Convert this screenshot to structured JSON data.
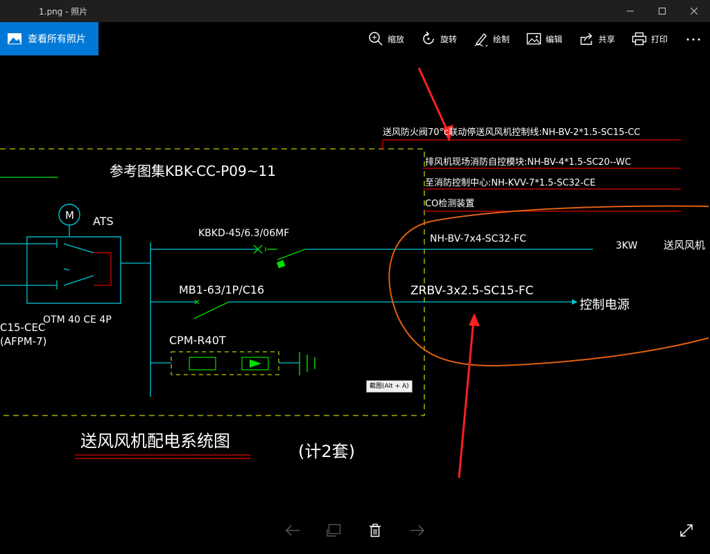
{
  "window": {
    "title": "1.png - 照片",
    "minimize_icon": "minimize-icon",
    "maximize_icon": "maximize-icon",
    "close_icon": "close-icon"
  },
  "appbar": {
    "view_all_label": "查看所有照片",
    "tools": [
      {
        "label": "缩放",
        "icon": "zoom-icon"
      },
      {
        "label": "旋转",
        "icon": "rotate-icon"
      },
      {
        "label": "绘制",
        "icon": "draw-icon"
      },
      {
        "label": "编辑",
        "icon": "edit-icon"
      },
      {
        "label": "共享",
        "icon": "share-icon"
      },
      {
        "label": "打印",
        "icon": "print-icon"
      }
    ],
    "more_icon": "more-icon"
  },
  "drawing": {
    "ref_title": "参考图集KBK-CC-P09~11",
    "motor": "M",
    "ats": "ATS",
    "otm": "OTM 40 CE 4P",
    "left_cut_1": "C15-CEC",
    "left_cut_2": "(AFPM-7)",
    "kbkd": "KBKD-45/6.3/06MF",
    "mb1": "MB1-63/1P/C16",
    "cpm": "CPM-R40T",
    "line1": "送风防火阀70°c联动停送风风机控制线:NH-BV-2*1.5-SC15-CC",
    "line2": "排风机现场消防自控模块:NH-BV-4*1.5-SC20--WC",
    "line3": "至消防控制中心:NH-KVV-7*1.5-SC32-CE",
    "line4": "CO检测装置",
    "cable1": "NH-BV-7x4-SC32-FC",
    "power": "3KW",
    "fan": "送风风机",
    "cable2": "ZRBV-3x2.5-SC15-FC",
    "ctrl": "控制电源",
    "diagram_title": "送风风机配电系统图",
    "count": "(计2套)",
    "tooltip": "截图(Alt + A)"
  },
  "bottom": {
    "prev_icon": "arrow-left-icon",
    "slideshow_icon": "slideshow-icon",
    "delete_icon": "trash-icon",
    "next_icon": "arrow-right-icon",
    "fullscreen_icon": "fullscreen-icon"
  },
  "colors": {
    "titlebar": "#1f1f1f",
    "accent": "#0078d7",
    "cad_cyan": "#00c8d8",
    "cad_green": "#00e000",
    "cad_yellow": "#c8c800",
    "cad_red": "#e00000",
    "annotation_orange": "#e06010",
    "annotation_red": "#ff2020"
  }
}
